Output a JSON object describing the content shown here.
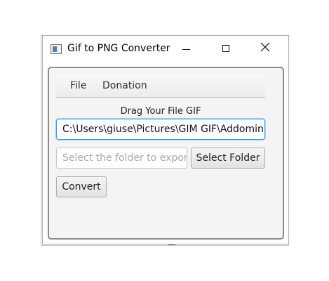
{
  "window": {
    "title": "Gif to PNG Converter"
  },
  "menu": {
    "items": [
      {
        "label": "File"
      },
      {
        "label": "Donation"
      }
    ]
  },
  "form": {
    "drag_label": "Drag Your File GIF",
    "path_value": "C:\\Users\\giuse\\Pictures\\GIM GIF\\Addomin",
    "folder_placeholder": "Select the folder to expor",
    "select_folder_label": "Select Folder",
    "convert_label": "Convert"
  },
  "colors": {
    "focus_border": "#3a9bd9",
    "content_bg": "#f4f4f4"
  }
}
